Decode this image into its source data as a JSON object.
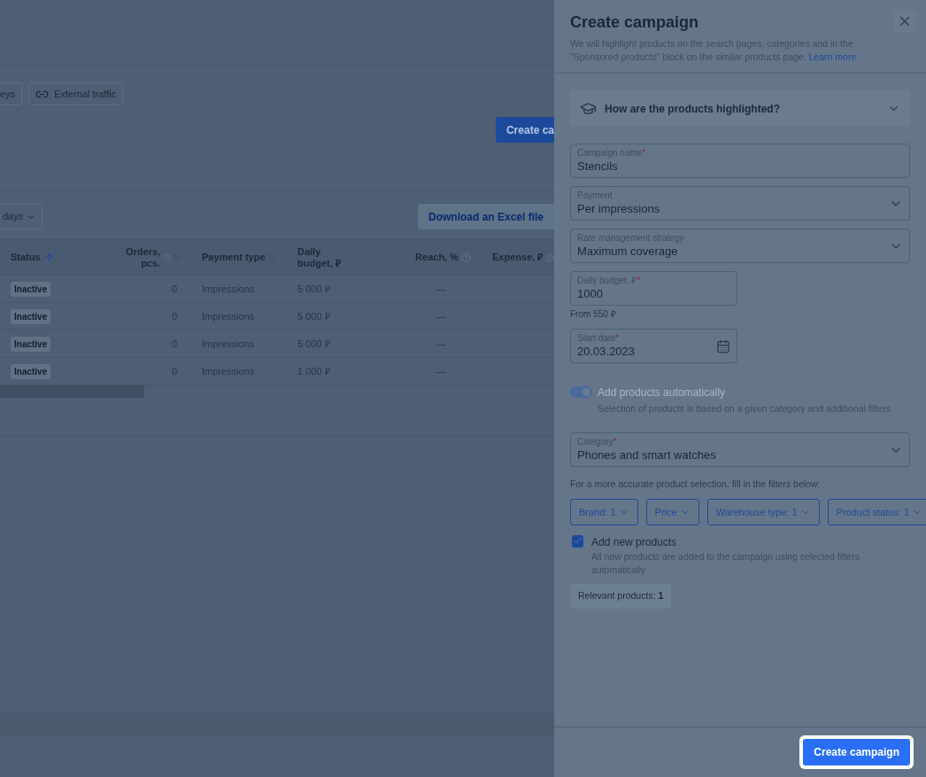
{
  "background": {
    "toolbar_buttons": [
      "eys",
      "External traffic"
    ],
    "create_button": "Create ca",
    "period_select": "days",
    "download_button": "Download an Excel file",
    "table": {
      "columns": [
        {
          "label": "Status",
          "sorted": true,
          "sortable": true,
          "help": false
        },
        {
          "label": "Orders, pcs.",
          "sorted": false,
          "sortable": true,
          "help": true
        },
        {
          "label": "Payment type",
          "sorted": false,
          "sortable": true,
          "help": false
        },
        {
          "label": "Daily budget, ₽",
          "sorted": false,
          "sortable": false,
          "help": false
        },
        {
          "label": "Reach, %",
          "sorted": false,
          "sortable": false,
          "help": true
        },
        {
          "label": "Expense, ₽",
          "sorted": false,
          "sortable": false,
          "help": true
        }
      ],
      "rows": [
        [
          "Inactive",
          "0",
          "Impressions",
          "5 000 ₽",
          "—",
          ""
        ],
        [
          "Inactive",
          "0",
          "Impressions",
          "5 000 ₽",
          "—",
          ""
        ],
        [
          "Inactive",
          "0",
          "Impressions",
          "5 000 ₽",
          "—",
          ""
        ],
        [
          "Inactive",
          "0",
          "Impressions",
          "1 000 ₽",
          "—",
          ""
        ]
      ]
    }
  },
  "panel": {
    "title": "Create campaign",
    "description": "We will highlight products on the search pages, categories and in the \"Sponsored products\" block on the similar products page.",
    "link": "Learn more",
    "accordion": {
      "label": "How are the products highlighted?",
      "expanded": false
    },
    "fields": [
      {
        "kind": "text",
        "label": "Campaign name",
        "required": "*",
        "value": "Stencils"
      },
      {
        "kind": "select",
        "label": "Payment",
        "value": "Per impressions"
      },
      {
        "kind": "select",
        "label": "Rate management strategy",
        "value": "Maximum coverage"
      },
      {
        "kind": "text",
        "label": "Daily budget, ₽",
        "required": "*",
        "value": "1000",
        "hint": "From 550 ₽"
      },
      {
        "kind": "date",
        "label": "Start date",
        "required": "*",
        "value": "20.03.2023"
      }
    ],
    "toggle": {
      "label": "Add products automatically",
      "description": "Selection of products is based on a given category and additional filters",
      "on": true,
      "disabled": true
    },
    "category": {
      "kind": "select",
      "label": "Category",
      "required": "*",
      "value": "Phones and smart watches"
    },
    "filters_hint": "For a more accurate product selection, fill in the filters below:",
    "filters": [
      "Brand: 1",
      "Price",
      "Warehouse type: 1",
      "Product status: 1"
    ],
    "checkbox": {
      "label": "Add new products",
      "description": "All new products are added to the campaign using selected filters automatically",
      "checked": true
    },
    "relevant": "Relevant products: **1**",
    "submit": "Create campaign"
  }
}
